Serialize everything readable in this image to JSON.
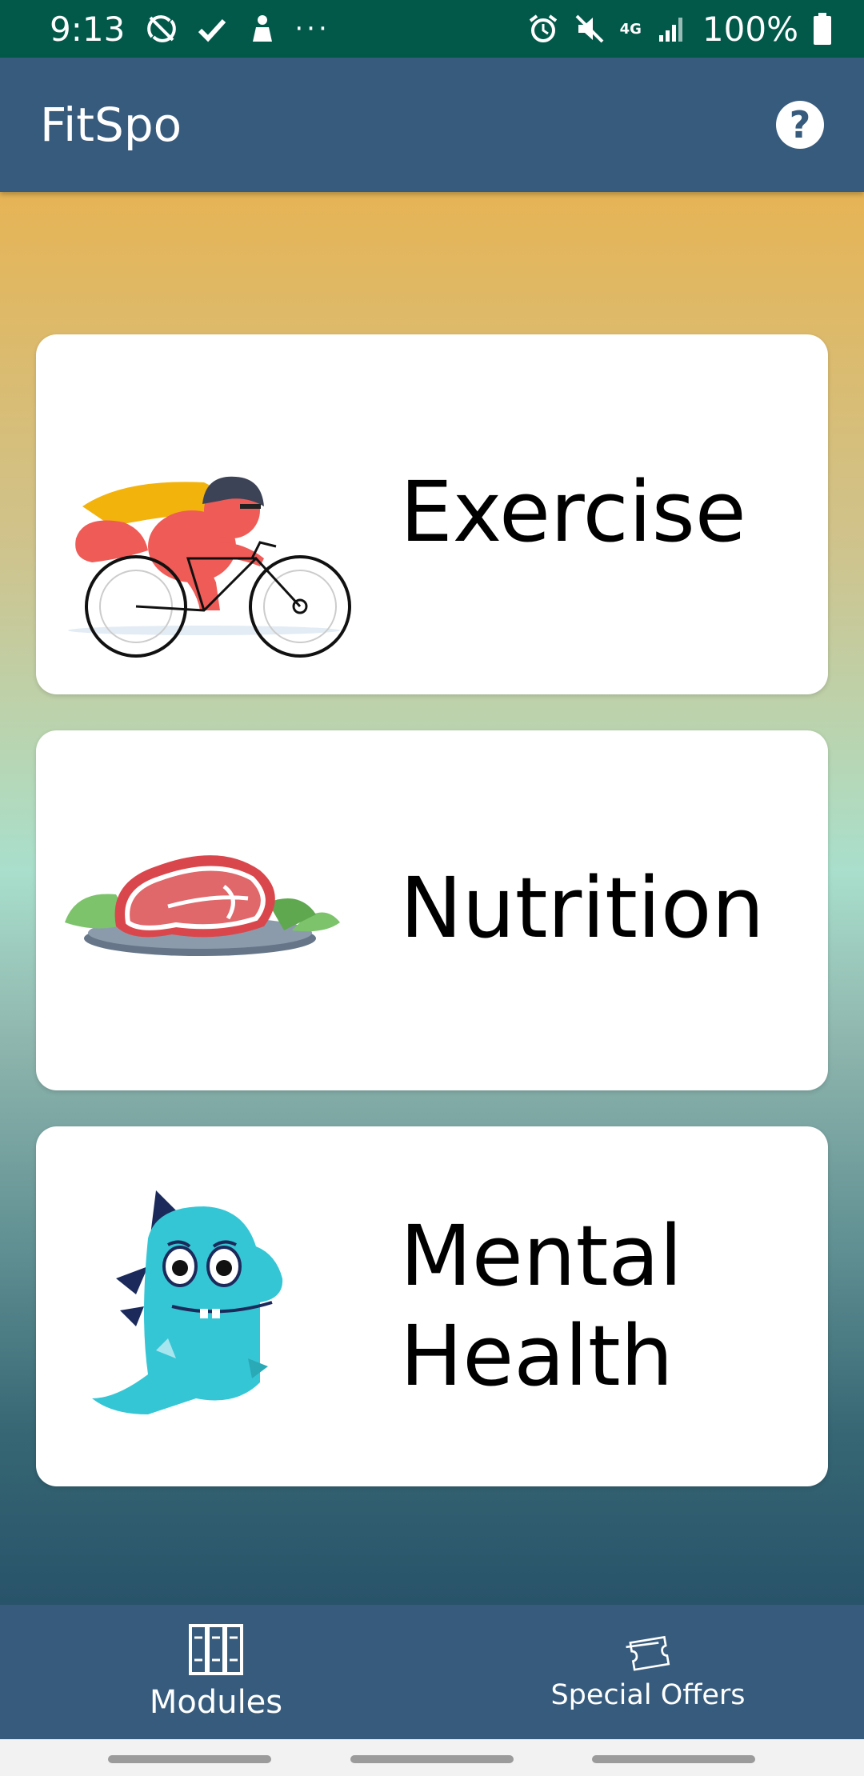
{
  "status_bar": {
    "time": "9:13",
    "battery": "100%",
    "network": "4G"
  },
  "app_bar": {
    "title": "FitSpo",
    "help_label": "?"
  },
  "modules": [
    {
      "label": "Exercise",
      "illustration": "cyclist-illustration"
    },
    {
      "label": "Nutrition",
      "illustration": "steak-plate-illustration"
    },
    {
      "label_line1": "Mental",
      "label_line2": "Health",
      "illustration": "dinosaur-illustration"
    }
  ],
  "bottom_nav": {
    "items": [
      {
        "label": "Modules",
        "icon": "books-icon"
      },
      {
        "label": "Special Offers",
        "icon": "ticket-icon"
      }
    ]
  },
  "colors": {
    "status_bar": "#02594a",
    "app_bar": "#375b7d",
    "gradient_top": "#e6b455",
    "gradient_mid": "#a9dfcc",
    "gradient_bottom": "#28536a"
  }
}
